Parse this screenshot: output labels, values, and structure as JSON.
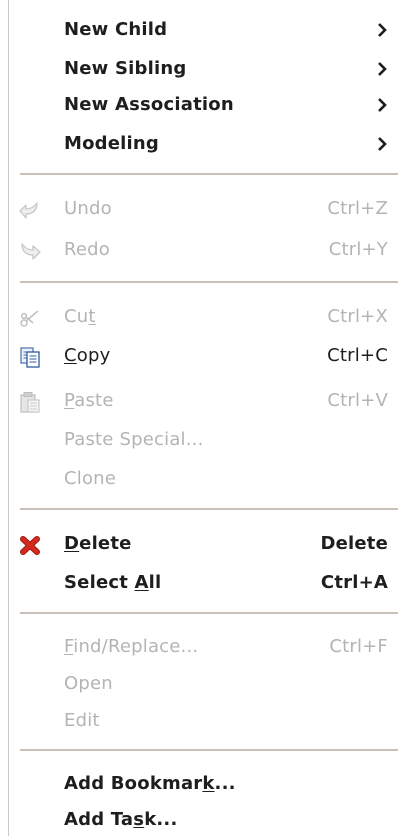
{
  "menu": {
    "submenus": [
      {
        "label": "New Child"
      },
      {
        "label": "New Sibling"
      },
      {
        "label": "New Association"
      },
      {
        "label": "Modeling"
      }
    ],
    "undo": {
      "label": "Undo",
      "shortcut": "Ctrl+Z",
      "enabled": false
    },
    "redo": {
      "label": "Redo",
      "shortcut": "Ctrl+Y",
      "enabled": false
    },
    "cut": {
      "pre": "Cu",
      "mn": "t",
      "post": "",
      "shortcut": "Ctrl+X",
      "enabled": false
    },
    "copy": {
      "pre": "",
      "mn": "C",
      "post": "opy",
      "shortcut": "Ctrl+C",
      "enabled": true
    },
    "paste": {
      "pre": "",
      "mn": "P",
      "post": "aste",
      "shortcut": "Ctrl+V",
      "enabled": false
    },
    "paste_special": {
      "label": "Paste Special...",
      "enabled": false
    },
    "clone": {
      "label": "Clone",
      "enabled": false
    },
    "delete": {
      "pre": "",
      "mn": "D",
      "post": "elete",
      "shortcut": "Delete",
      "enabled": true
    },
    "select_all": {
      "pre": "Select ",
      "mn": "A",
      "post": "ll",
      "shortcut": "Ctrl+A",
      "enabled": true
    },
    "find_replace": {
      "pre": "",
      "mn": "F",
      "post": "ind/Replace...",
      "shortcut": "Ctrl+F",
      "enabled": false
    },
    "open": {
      "label": "Open",
      "enabled": false
    },
    "edit": {
      "label": "Edit",
      "enabled": false
    },
    "add_bookmark": {
      "pre": "Add Bookmar",
      "mn": "k",
      "post": "...",
      "enabled": true
    },
    "add_task": {
      "pre": "Add Ta",
      "mn": "s",
      "post": "k...",
      "enabled": true
    }
  },
  "colors": {
    "text": "#1e1e1e",
    "disabled_text": "#b4b4b4",
    "separator": "#c9c1b7",
    "delete_icon": "#d42a1e"
  },
  "icons": {
    "undo": "undo-arrow-icon",
    "redo": "redo-arrow-icon",
    "cut": "scissors-icon",
    "copy": "copy-documents-icon",
    "paste": "paste-clipboard-icon",
    "delete": "red-x-delete-icon",
    "submenu": "chevron-right-icon"
  }
}
